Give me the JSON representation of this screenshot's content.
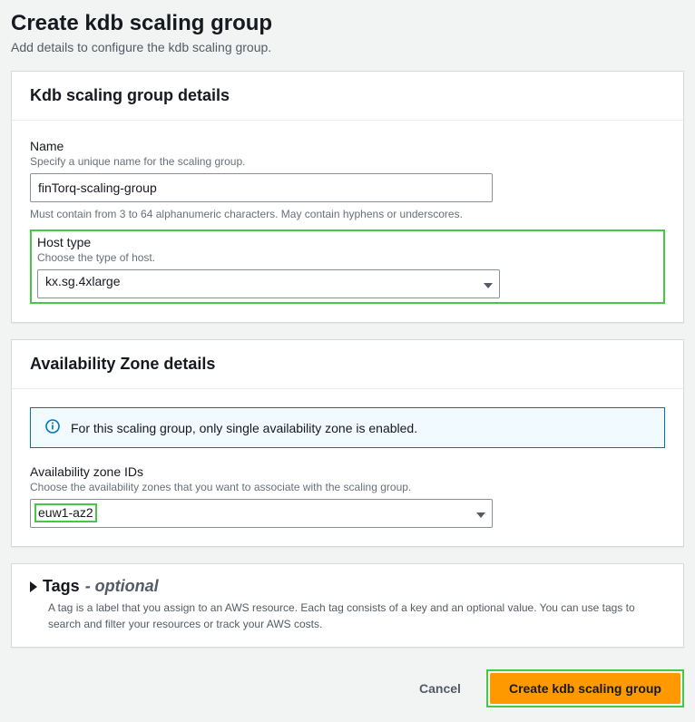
{
  "page": {
    "title": "Create kdb scaling group",
    "subtitle": "Add details to configure the kdb scaling group."
  },
  "details_panel": {
    "title": "Kdb scaling group details",
    "name": {
      "label": "Name",
      "hint": "Specify a unique name for the scaling group.",
      "value": "finTorq-scaling-group",
      "constraint": "Must contain from 3 to 64 alphanumeric characters. May contain hyphens or underscores."
    },
    "host_type": {
      "label": "Host type",
      "hint": "Choose the type of host.",
      "value": "kx.sg.4xlarge"
    }
  },
  "az_panel": {
    "title": "Availability Zone details",
    "info": "For this scaling group, only single availability zone is enabled.",
    "az_ids": {
      "label": "Availability zone IDs",
      "hint": "Choose the availability zones that you want to associate with the scaling group.",
      "value": "euw1-az2"
    }
  },
  "tags_panel": {
    "title": "Tags",
    "optional": "- optional",
    "desc": "A tag is a label that you assign to an AWS resource. Each tag consists of a key and an optional value. You can use tags to search and filter your resources or track your AWS costs."
  },
  "footer": {
    "cancel": "Cancel",
    "submit": "Create kdb scaling group"
  }
}
